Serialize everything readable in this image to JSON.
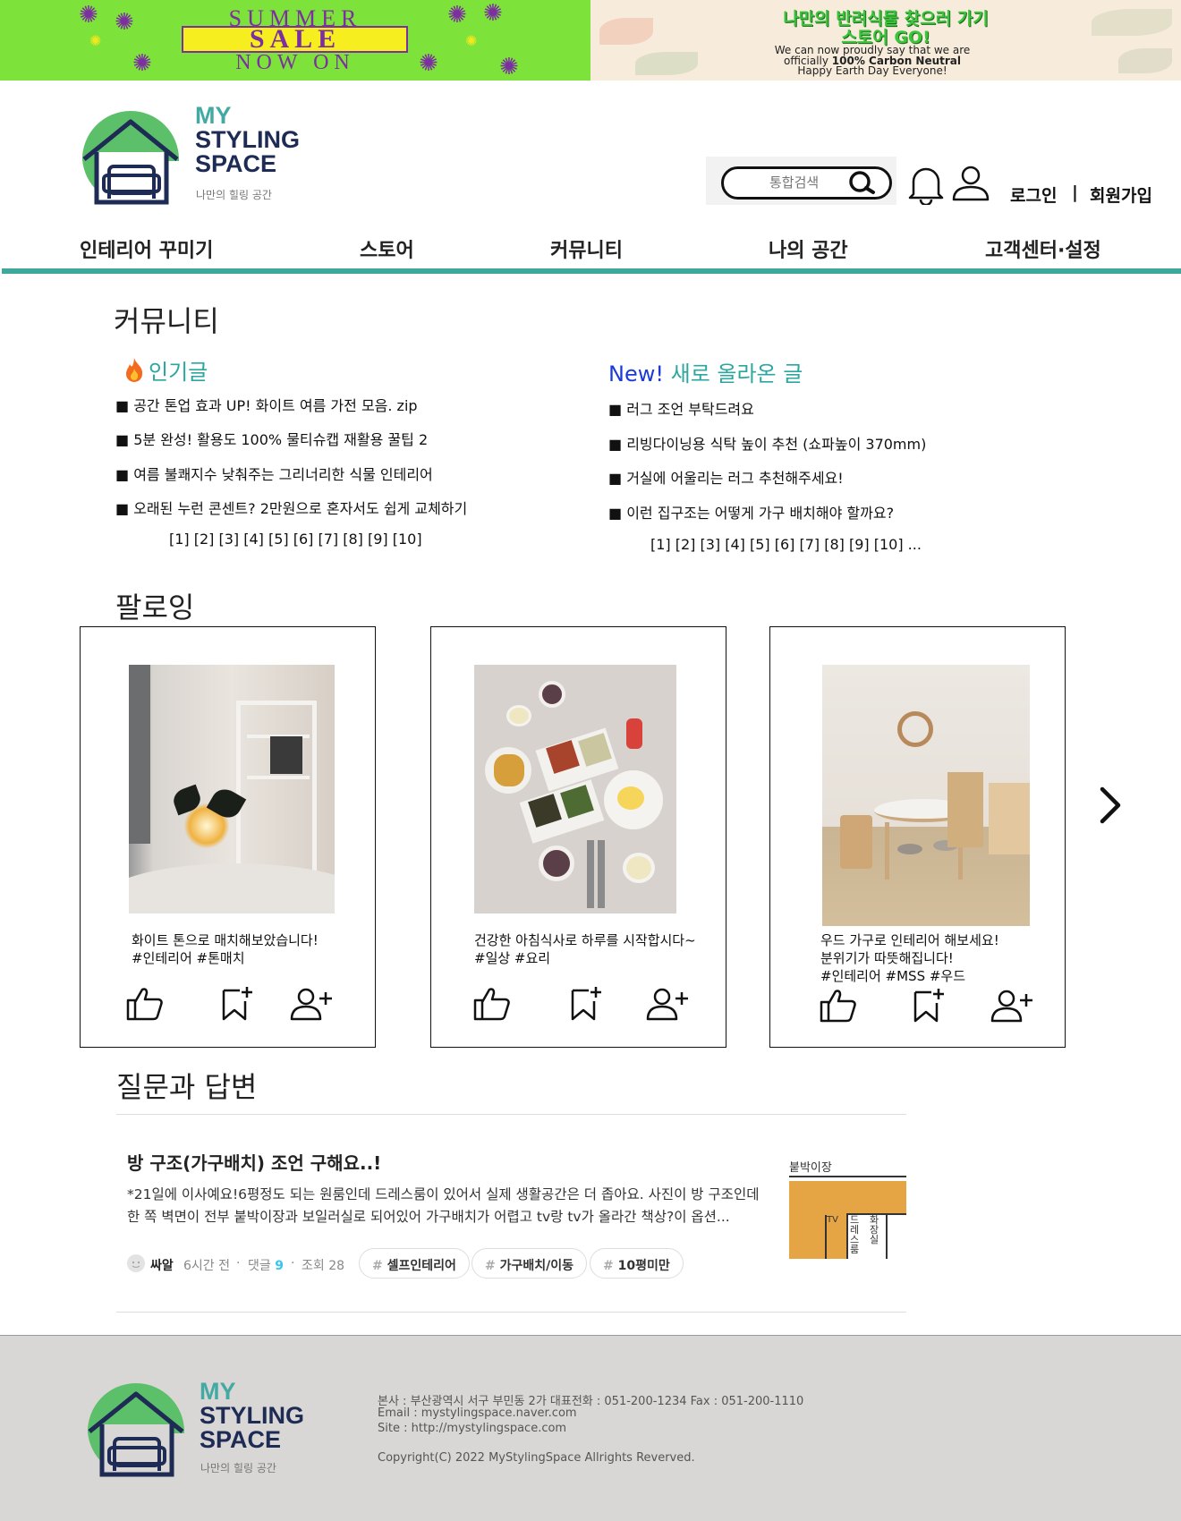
{
  "banners": {
    "sale": {
      "line1": "SUMMER",
      "line2": "SALE",
      "line3": "NOW ON"
    },
    "promo": {
      "line1": "나만의 반려식물 찾으러 가기",
      "line2": "스토어 GO!",
      "sub1": "We can now proudly say that we are",
      "sub2_prefix": "officially ",
      "sub2_bold": "100% Carbon Neutral",
      "sub3": "Happy Earth Day Everyone!"
    }
  },
  "logo": {
    "m1": "MY",
    "m2": "STYLING",
    "m3": "SPACE",
    "tagline": "나만의 힐링 공간"
  },
  "header": {
    "search_placeholder": "통합검색",
    "login": "로그인",
    "separator": "|",
    "signup": "회원가입"
  },
  "nav": [
    "인테리어 꾸미기",
    "스토어",
    "커뮤니티",
    "나의 공간",
    "고객센터·설정"
  ],
  "community": {
    "title": "커뮤니티",
    "popular": {
      "title": "인기글",
      "posts": [
        "공간 톤업 효과 UP! 화이트 여름 가전 모음. zip",
        "5분 완성! 활용도 100% 물티슈캡 재활용 꿀팁 2",
        "여름 불쾌지수 낮춰주는 그리너리한 식물 인테리어",
        "오래된 누런 콘센트? 2만원으로 혼자서도 쉽게 교체하기"
      ],
      "pager": "[1] [2] [3] [4] [5] [6] [7] [8] [9] [10]"
    },
    "latest": {
      "title_prefix": "New!",
      "title": "새로 올라온 글",
      "posts": [
        "러그 조언 부탁드려요",
        "리빙다이닝용 식탁 높이 추천 (쇼파높이 370mm)",
        "거실에 어울리는 러그 추천해주세요!",
        "이런 집구조는 어떻게 가구 배치해야 할까요?"
      ],
      "pager": "[1] [2] [3] [4] [5] [6] [7] [8] [9] [10] ..."
    }
  },
  "following": {
    "title": "팔로잉",
    "cards": [
      {
        "line1": "화이트 톤으로 매치해보았습니다!",
        "line2": "#인테리어 #톤매치",
        "line3": ""
      },
      {
        "line1": "건강한 아침식사로 하루를 시작합시다~",
        "line2": "#일상 #요리",
        "line3": ""
      },
      {
        "line1": "우드 가구로 인테리어 해보세요!",
        "line2": "분위기가 따뜻해집니다!",
        "line3": "#인테리어 #MSS #우드"
      }
    ]
  },
  "qa": {
    "title": "질문과 답변",
    "item": {
      "title": "방 구조(가구배치) 조언 구해요..!",
      "body": "*21일에 이사예요!6평정도 되는 원룸인데 드레스룸이 있어서 실제 생활공간은 더 좁아요. 사진이 방 구조인데 한 쪽 벽면이 전부 붙박이장과 보일러실로 되어있어 가구배치가 어렵고 tv랑 tv가 올라간 책상?이 옵션...",
      "author": "싸알",
      "time": "6시간 전",
      "dot": "·",
      "comments_label": "댓글",
      "comments": "9",
      "views": "조회 28",
      "tags": [
        "셀프인테리어",
        "가구배치/이동",
        "10평미만"
      ],
      "thumb_text1": "붙박이장",
      "thumb_text2": "드레스룸",
      "thumb_text3": "화장실"
    }
  },
  "footer": {
    "address": "본사 : 부산광역시 서구 부민동 2가  대표전화 : 051-200-1234 Fax : 051-200-1110",
    "email": "Email : mystylingspace.naver.com",
    "site": "Site : http://mystylingspace.com",
    "copyright": "Copyright(C) 2022 MyStylingSpace Allrights Reverved."
  },
  "colors": {
    "accent": "#3fa89d",
    "logo_green": "#5cbf6a",
    "logo_navy": "#1e2b54",
    "sale_green": "#7de23a",
    "new_blue": "#1c3bd6"
  }
}
